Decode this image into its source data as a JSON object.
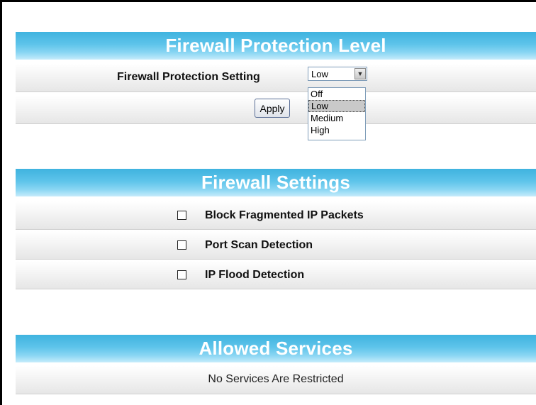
{
  "protection_level": {
    "header": "Firewall Protection Level",
    "setting_label": "Firewall Protection Setting",
    "selected_value": "Low",
    "options": [
      "Off",
      "Low",
      "Medium",
      "High"
    ],
    "apply_label": "Apply"
  },
  "firewall_settings": {
    "header": "Firewall Settings",
    "items": [
      {
        "label": "Block Fragmented IP Packets",
        "checked": false
      },
      {
        "label": "Port Scan Detection",
        "checked": false
      },
      {
        "label": "IP Flood Detection",
        "checked": false
      }
    ]
  },
  "allowed_services": {
    "header": "Allowed Services",
    "message": "No Services Are Restricted"
  },
  "colors": {
    "header_blue": "#3fb3df",
    "header_text": "#ffffff"
  }
}
